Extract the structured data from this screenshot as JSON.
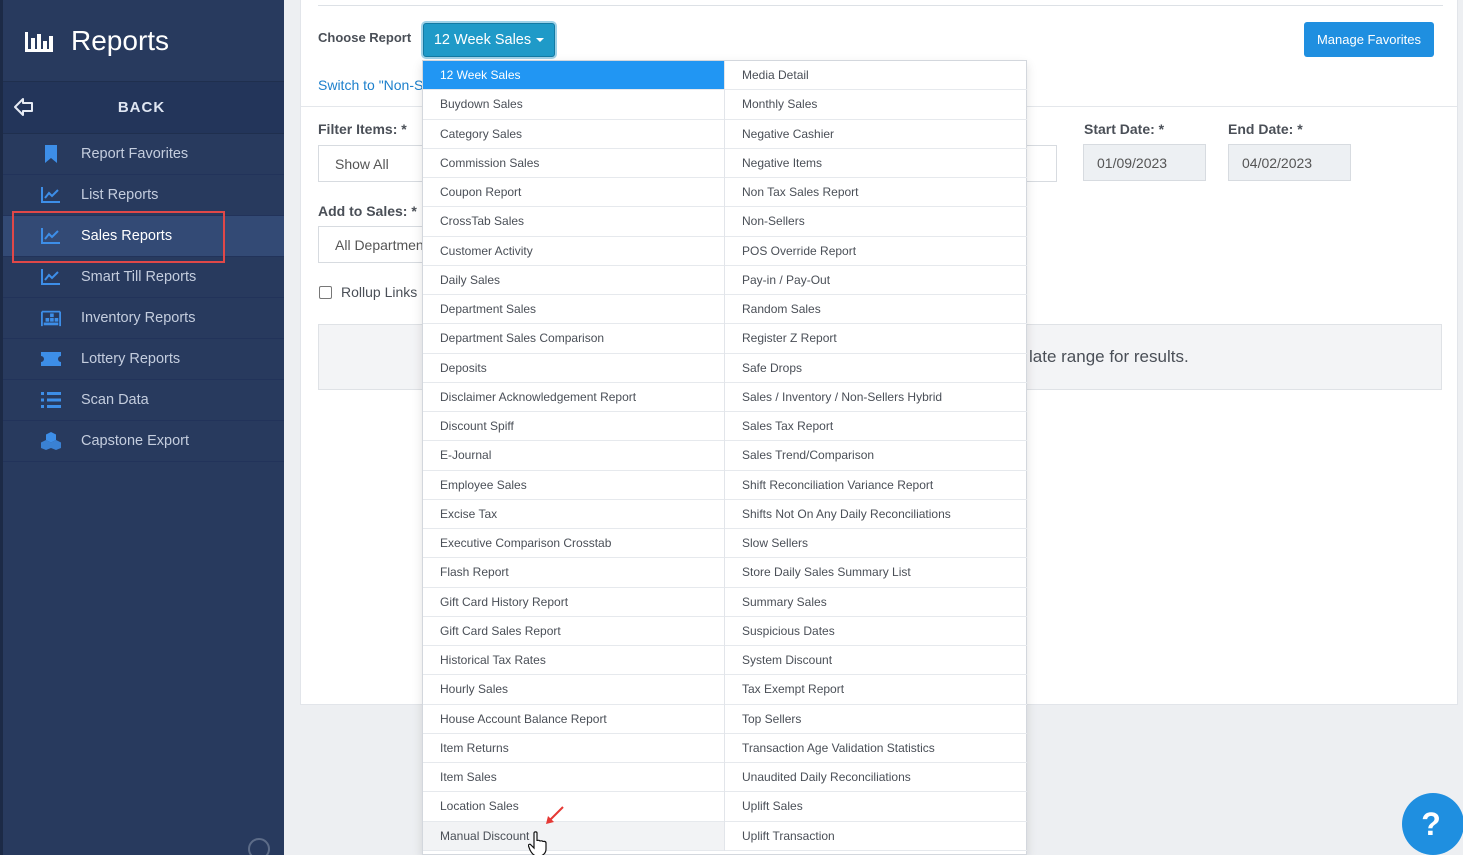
{
  "sidebar": {
    "title": "Reports",
    "back_label": "BACK",
    "items": [
      {
        "label": "Report Favorites",
        "icon": "bookmark-icon"
      },
      {
        "label": "List Reports",
        "icon": "line-chart-icon"
      },
      {
        "label": "Sales Reports",
        "icon": "line-chart-icon"
      },
      {
        "label": "Smart Till Reports",
        "icon": "line-chart-icon"
      },
      {
        "label": "Inventory Reports",
        "icon": "warehouse-icon"
      },
      {
        "label": "Lottery Reports",
        "icon": "ticket-icon"
      },
      {
        "label": "Scan Data",
        "icon": "list-icon"
      },
      {
        "label": "Capstone Export",
        "icon": "cubes-icon"
      }
    ]
  },
  "header": {
    "choose_label": "Choose Report",
    "selected_report": "12 Week Sales",
    "manage_label": "Manage Favorites",
    "switch_text": "Switch to \"Non-S"
  },
  "filters": {
    "filter_items_label": "Filter Items: *",
    "filter_items_value": "Show All",
    "add_to_sales_label": "Add to Sales: *",
    "add_to_sales_value": "All Departmen",
    "start_date_label": "Start Date: *",
    "start_date_value": "01/09/2023",
    "end_date_label": "End Date: *",
    "end_date_value": "04/02/2023",
    "rollup_label": "Rollup Links"
  },
  "results_text": "late range for results.",
  "menu": {
    "left": [
      "12 Week Sales",
      "Buydown Sales",
      "Category Sales",
      "Commission Sales",
      "Coupon Report",
      "CrossTab Sales",
      "Customer Activity",
      "Daily Sales",
      "Department Sales",
      "Department Sales Comparison",
      "Deposits",
      "Disclaimer Acknowledgement Report",
      "Discount Spiff",
      "E-Journal",
      "Employee Sales",
      "Excise Tax",
      "Executive Comparison Crosstab",
      "Flash Report",
      "Gift Card History Report",
      "Gift Card Sales Report",
      "Historical Tax Rates",
      "Hourly Sales",
      "House Account Balance Report",
      "Item Returns",
      "Item Sales",
      "Location Sales",
      "Manual Discount"
    ],
    "right": [
      "Media Detail",
      "Monthly Sales",
      "Negative Cashier",
      "Negative Items",
      "Non Tax Sales Report",
      "Non-Sellers",
      "POS Override Report",
      "Pay-in / Pay-Out",
      "Random Sales",
      "Register Z Report",
      "Safe Drops",
      "Sales / Inventory / Non-Sellers Hybrid",
      "Sales Tax Report",
      "Sales Trend/Comparison",
      "Shift Reconciliation Variance Report",
      "Shifts Not On Any Daily Reconciliations",
      "Slow Sellers",
      "Store Daily Sales Summary List",
      "Summary Sales",
      "Suspicious Dates",
      "System Discount",
      "Tax Exempt Report",
      "Top Sellers",
      "Transaction Age Validation Statistics",
      "Unaudited Daily Reconciliations",
      "Uplift Sales",
      "Uplift Transaction"
    ]
  },
  "help_label": "?",
  "colors": {
    "sidebar_bg": "#283a5e",
    "accent": "#1f9ac8",
    "selected": "#2196f3",
    "highlight_border": "#e04848"
  }
}
